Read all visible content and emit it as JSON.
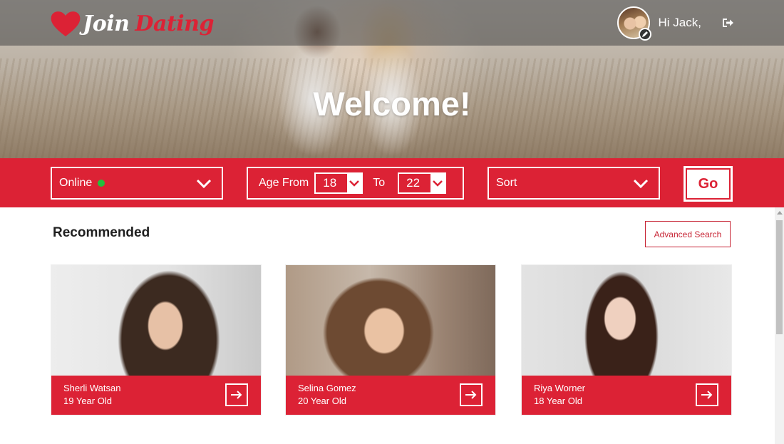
{
  "header": {
    "logo": {
      "word1": "Join",
      "word2": "Dating"
    },
    "greeting": "Hi Jack,"
  },
  "hero": {
    "title": "Welcome!"
  },
  "filters": {
    "status": {
      "label": "Online",
      "indicator_color": "#23c03c"
    },
    "age": {
      "from_label": "Age From",
      "from_value": "18",
      "to_label": "To",
      "to_value": "22"
    },
    "sort": {
      "label": "Sort"
    },
    "go_label": "Go"
  },
  "section": {
    "title": "Recommended",
    "advanced_search_label": "Advanced Search"
  },
  "profiles": [
    {
      "name": "Sherli Watsan",
      "age": "19 Year Old"
    },
    {
      "name": "Selina Gomez",
      "age": "20 Year Old"
    },
    {
      "name": "Riya Worner",
      "age": "18 Year Old"
    }
  ],
  "colors": {
    "accent": "#dc2235",
    "online": "#23c03c"
  },
  "icons": {
    "logo": "heart-icon",
    "avatar_badge": "pencil-icon",
    "logout": "sign-out-icon",
    "dropdown": "chevron-down-icon",
    "card_action": "arrow-right-icon"
  }
}
